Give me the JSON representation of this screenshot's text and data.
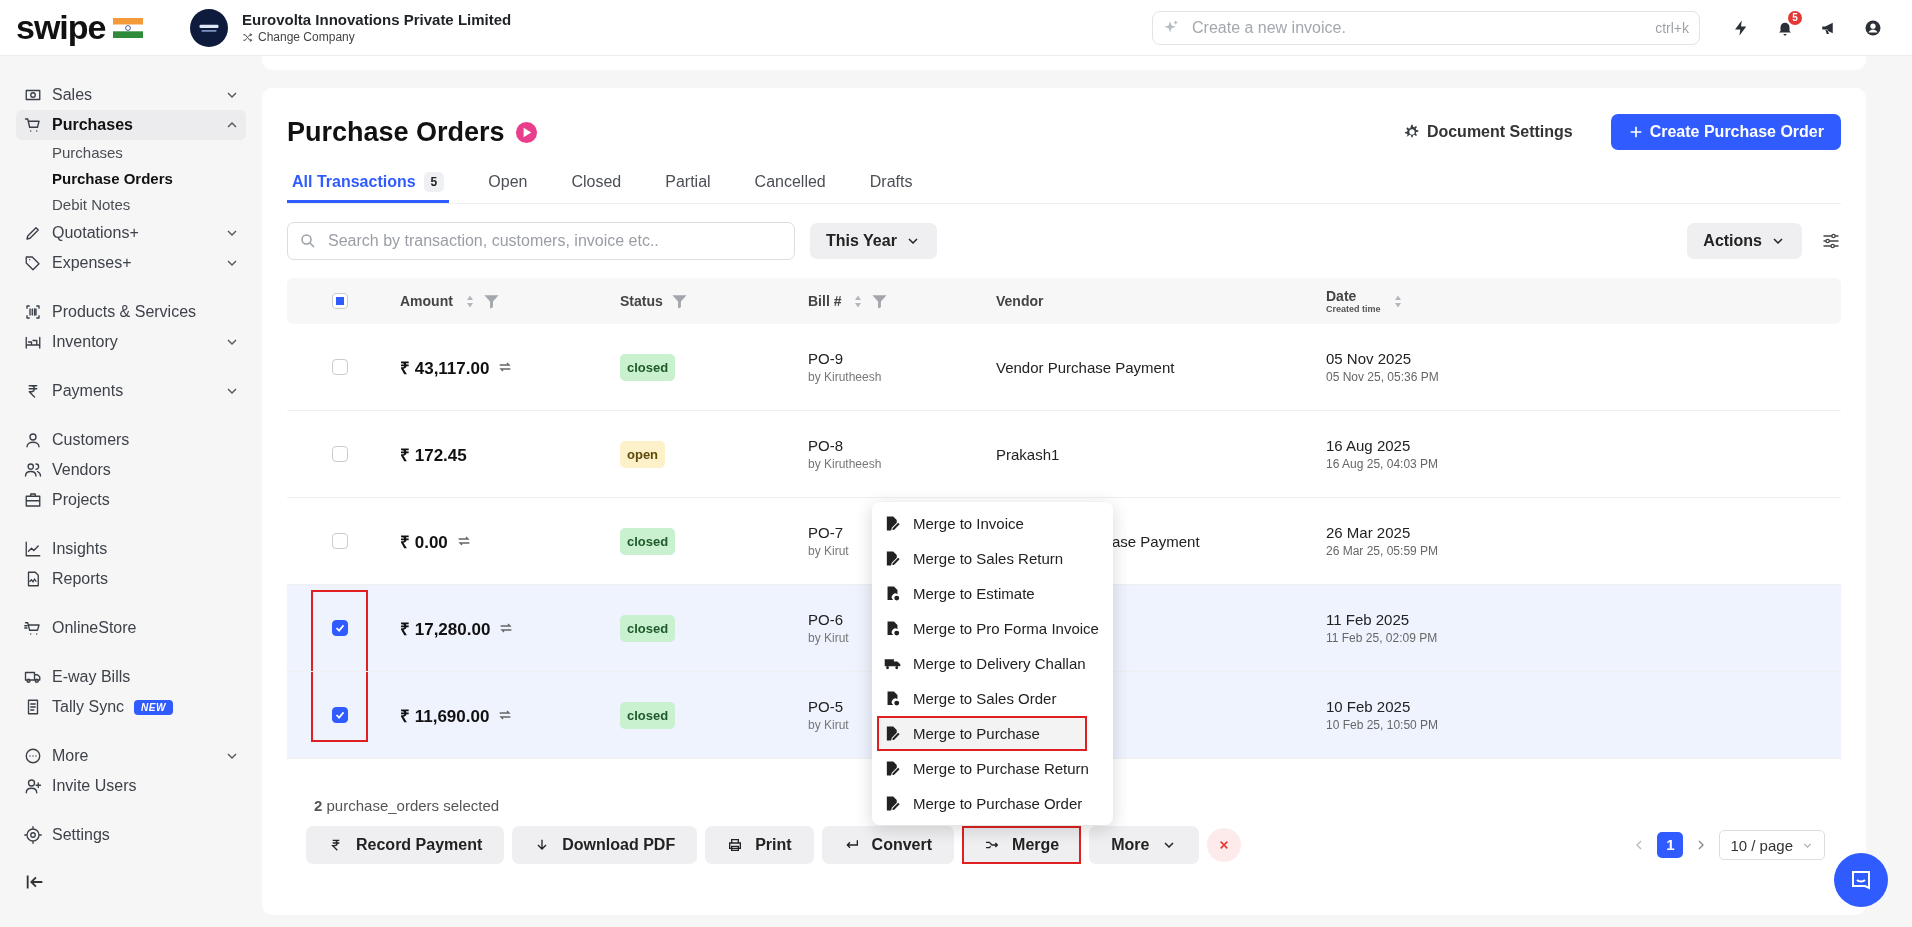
{
  "brand": {
    "name": "swipe"
  },
  "company": {
    "name": "Eurovolta Innovations Private Limited",
    "action": "Change Company"
  },
  "search": {
    "placeholder": "Create a new invoice.",
    "shortcut": "ctrl+k"
  },
  "notifications": {
    "count": "5"
  },
  "sidebar": {
    "groups": [
      {
        "items": [
          {
            "label": "Sales",
            "expandable": true,
            "expanded": false,
            "selected": false
          },
          {
            "label": "Purchases",
            "expandable": true,
            "expanded": true,
            "selected": true,
            "children": [
              {
                "label": "Purchases",
                "selected": false
              },
              {
                "label": "Purchase Orders",
                "selected": true
              },
              {
                "label": "Debit Notes",
                "selected": false
              }
            ]
          },
          {
            "label": "Quotations+",
            "expandable": true,
            "expanded": false,
            "selected": false
          },
          {
            "label": "Expenses+",
            "expandable": true,
            "expanded": false,
            "selected": false
          }
        ]
      },
      {
        "items": [
          {
            "label": "Products & Services",
            "expandable": false,
            "selected": false
          },
          {
            "label": "Inventory",
            "expandable": true,
            "expanded": false,
            "selected": false
          }
        ]
      },
      {
        "items": [
          {
            "label": "Payments",
            "expandable": true,
            "expanded": false,
            "selected": false
          }
        ]
      },
      {
        "items": [
          {
            "label": "Customers",
            "expandable": false,
            "selected": false
          },
          {
            "label": "Vendors",
            "expandable": false,
            "selected": false
          },
          {
            "label": "Projects",
            "expandable": false,
            "selected": false
          }
        ]
      },
      {
        "items": [
          {
            "label": "Insights",
            "expandable": false,
            "selected": false
          },
          {
            "label": "Reports",
            "expandable": false,
            "selected": false
          }
        ]
      },
      {
        "items": [
          {
            "label": "OnlineStore",
            "expandable": false,
            "selected": false
          }
        ]
      },
      {
        "items": [
          {
            "label": "E-way Bills",
            "expandable": false,
            "selected": false
          },
          {
            "label": "Tally Sync",
            "expandable": false,
            "selected": false,
            "badge": "NEW"
          }
        ]
      },
      {
        "items": [
          {
            "label": "More",
            "expandable": true,
            "expanded": false,
            "selected": false
          },
          {
            "label": "Invite Users",
            "expandable": false,
            "selected": false
          }
        ]
      },
      {
        "items": [
          {
            "label": "Settings",
            "expandable": false,
            "selected": false
          }
        ]
      }
    ]
  },
  "page": {
    "title": "Purchase Orders",
    "settings_button": "Document Settings",
    "create_button": "Create Purchase Order"
  },
  "tabs": [
    {
      "label": "All Transactions",
      "count": "5",
      "selected": true
    },
    {
      "label": "Open",
      "selected": false
    },
    {
      "label": "Closed",
      "selected": false
    },
    {
      "label": "Partial",
      "selected": false
    },
    {
      "label": "Cancelled",
      "selected": false
    },
    {
      "label": "Drafts",
      "selected": false
    }
  ],
  "filters": {
    "placeholder": "Search by transaction, customers, invoice etc..",
    "period": "This Year",
    "actions": "Actions"
  },
  "table": {
    "select_all": {
      "indeterminate": true
    },
    "columns": [
      {
        "label": "Amount",
        "sortable": true,
        "filterable": true
      },
      {
        "label": "Status",
        "sortable": false,
        "filterable": true
      },
      {
        "label": "Bill #",
        "sortable": true,
        "filterable": true
      },
      {
        "label": "Vendor",
        "sortable": false,
        "filterable": false
      },
      {
        "label": "Date",
        "sublabel": "Created time",
        "sortable": true,
        "filterable": false
      }
    ],
    "rows": [
      {
        "selected": false,
        "annotated": false,
        "amount": "₹ 43,117.00",
        "synced": true,
        "status": "closed",
        "bill": "PO-9",
        "author": "by Kirutheesh",
        "vendor": "Vendor Purchase Payment",
        "covered": false,
        "date": "05 Nov 2025",
        "created": "05 Nov 25, 05:36 PM"
      },
      {
        "selected": false,
        "annotated": false,
        "amount": "₹ 172.45",
        "synced": false,
        "status": "open",
        "bill": "PO-8",
        "author": "by Kirutheesh",
        "vendor": "Prakash1",
        "covered": false,
        "date": "16 Aug 2025",
        "created": "16 Aug 25, 04:03 PM"
      },
      {
        "selected": false,
        "annotated": false,
        "amount": "₹ 0.00",
        "synced": true,
        "status": "closed",
        "bill": "PO-7",
        "author": "by Kirut",
        "vendor": "ase Payment",
        "covered": true,
        "date": "26 Mar 2025",
        "created": "26 Mar 25, 05:59 PM"
      },
      {
        "selected": true,
        "annotated": true,
        "amount": "₹ 17,280.00",
        "synced": true,
        "status": "closed",
        "bill": "PO-6",
        "author": "by Kirut",
        "covered": true,
        "date": "11 Feb 2025",
        "created": "11 Feb 25, 02:09 PM"
      },
      {
        "selected": true,
        "annotated": true,
        "amount": "₹ 11,690.00",
        "synced": true,
        "status": "closed",
        "bill": "PO-5",
        "author": "by Kirut",
        "covered": true,
        "date": "10 Feb 2025",
        "created": "10 Feb 25, 10:50 PM"
      }
    ]
  },
  "merge_menu": {
    "open": true,
    "items": [
      {
        "label": "Merge to Invoice",
        "highlighted": false
      },
      {
        "label": "Merge to Sales Return",
        "highlighted": false
      },
      {
        "label": "Merge to Estimate",
        "highlighted": false
      },
      {
        "label": "Merge to Pro Forma Invoice",
        "highlighted": false
      },
      {
        "label": "Merge to Delivery Challan",
        "highlighted": false
      },
      {
        "label": "Merge to Sales Order",
        "highlighted": false
      },
      {
        "label": "Merge to Purchase",
        "highlighted": true
      },
      {
        "label": "Merge to Purchase Return",
        "highlighted": false
      },
      {
        "label": "Merge to Purchase Order",
        "highlighted": false
      }
    ]
  },
  "bulk_bar": {
    "selection": "**2** purchase_orders selected",
    "buttons": [
      {
        "label": "Record Payment",
        "highlighted": false
      },
      {
        "label": "Download PDF",
        "highlighted": false
      },
      {
        "label": "Print",
        "highlighted": false
      },
      {
        "label": "Convert",
        "highlighted": false
      },
      {
        "label": "Merge",
        "highlighted": true
      },
      {
        "label": "More",
        "highlighted": false
      }
    ]
  },
  "pagination": {
    "pages": [
      {
        "label": "1",
        "selected": true
      }
    ],
    "page_size": "10 / page"
  }
}
